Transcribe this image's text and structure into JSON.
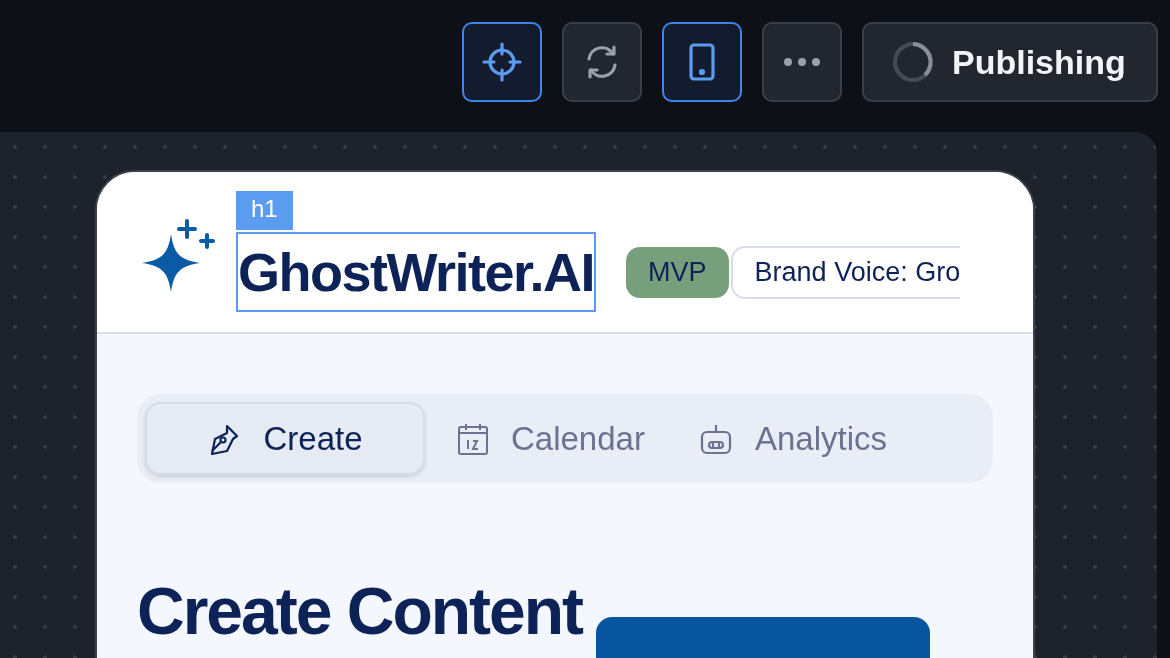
{
  "toolbar": {
    "buttons": [
      {
        "kind": "target",
        "selected": true
      },
      {
        "kind": "refresh",
        "selected": false
      },
      {
        "kind": "tablet",
        "selected": true
      },
      {
        "kind": "more",
        "selected": false
      }
    ],
    "publish_button": {
      "label": "Publishing"
    }
  },
  "preview": {
    "inspector_tag": "h1",
    "header": {
      "title": "GhostWriter.AI",
      "badge": "MVP",
      "brand_voice": "Brand Voice: Gro"
    },
    "tabs": [
      {
        "label": "Create",
        "kind": "pen",
        "selected": true
      },
      {
        "label": "Calendar",
        "kind": "calendar",
        "selected": false
      },
      {
        "label": "Analytics",
        "kind": "robot",
        "selected": false
      }
    ],
    "heading": "Create Content"
  }
}
